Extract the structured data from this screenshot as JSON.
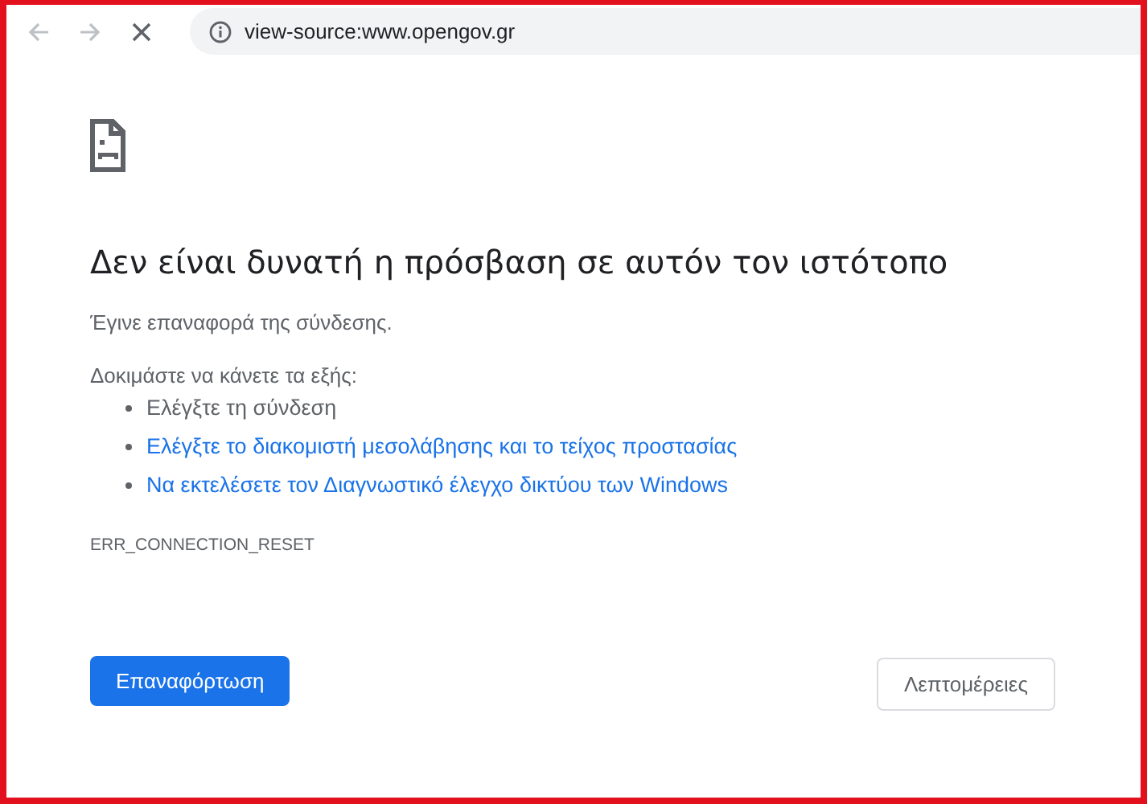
{
  "toolbar": {
    "address": "view-source:www.opengov.gr"
  },
  "error": {
    "title": "Δεν είναι δυνατή η πρόσβαση σε αυτόν τον ιστότοπο",
    "message": "Έγινε επαναφορά της σύνδεσης.",
    "suggestions_heading": "Δοκιμάστε να κάνετε τα εξής:",
    "suggestions": [
      {
        "kind": "text",
        "label": "Ελέγξτε τη σύνδεση"
      },
      {
        "kind": "link",
        "label": "Ελέγξτε το διακομιστή μεσολάβησης και το τείχος προστασίας"
      },
      {
        "kind": "link",
        "label": "Να εκτελέσετε τον Διαγνωστικό έλεγχο δικτύου των Windows"
      }
    ],
    "code": "ERR_CONNECTION_RESET"
  },
  "buttons": {
    "primary": "Επαναφόρτωση",
    "secondary": "Λεπτομέρειες"
  }
}
